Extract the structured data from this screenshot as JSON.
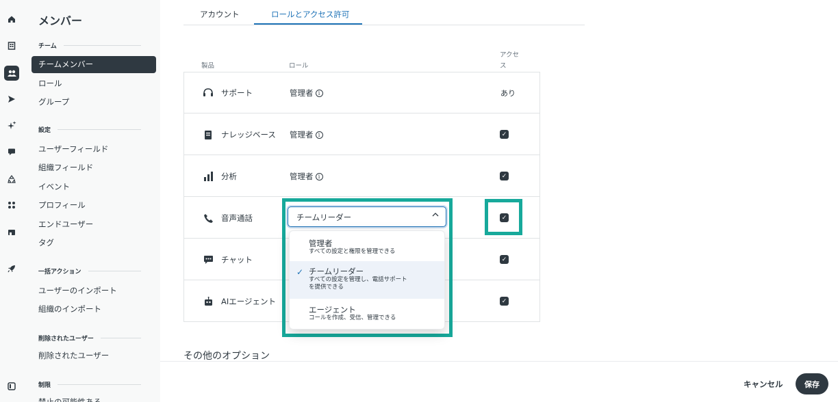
{
  "rail": {
    "icons": [
      "home-icon",
      "building-icon",
      "users-icon",
      "send-icon",
      "sparkles-icon",
      "chat-icon",
      "recycle-icon",
      "apps-icon",
      "store-icon",
      "rocket-icon",
      "panel-toggle-icon"
    ]
  },
  "nav": {
    "title": "メンバー",
    "sections": {
      "team": "チーム",
      "settings": "設定",
      "bulk": "一括アクション",
      "deleted": "削除されたユーザー",
      "limits": "制限"
    },
    "items": {
      "team_members": "チームメンバー",
      "roles": "ロール",
      "groups": "グループ",
      "user_fields": "ユーザーフィールド",
      "org_fields": "組織フィールド",
      "events": "イベント",
      "profiles": "プロフィール",
      "end_users": "エンドユーザー",
      "tags": "タグ",
      "user_import": "ユーザーのインポート",
      "org_import": "組織のインポート",
      "deleted_users": "削除されたユーザー",
      "partial_cut": "禁止の可能性ある"
    }
  },
  "tabs": {
    "account": "アカウント",
    "roles_access": "ロールとアクセス許可"
  },
  "table": {
    "headers": {
      "product": "製品",
      "role": "ロール",
      "access_line1": "アクセ",
      "access_line2": "ス"
    },
    "rows": [
      {
        "icon": "headset-icon",
        "product": "サポート",
        "role": "管理者",
        "access": "あり"
      },
      {
        "icon": "book-icon",
        "product": "ナレッジベース",
        "role": "管理者",
        "access": "checked"
      },
      {
        "icon": "bar-chart-icon",
        "product": "分析",
        "role": "管理者",
        "access": "checked"
      },
      {
        "icon": "phone-icon",
        "product": "音声通話",
        "role": "チームリーダー",
        "access": "checked"
      },
      {
        "icon": "message-icon",
        "product": "チャット",
        "role": "",
        "access": "checked"
      },
      {
        "icon": "robot-icon",
        "product": "AIエージェント",
        "role": "",
        "access": "checked"
      }
    ]
  },
  "select": {
    "value": "チームリーダー",
    "options": [
      {
        "label": "管理者",
        "desc": "すべての設定と権限を管理できる",
        "selected": false
      },
      {
        "label": "チームリーダー",
        "desc_line1": "すべての設定を管理し、電話サポート",
        "desc_line2": "を提供できる",
        "selected": true
      },
      {
        "label": "エージェント",
        "desc": "コールを作成、受信、管理できる",
        "selected": false
      }
    ]
  },
  "other_options": "その他のオプション",
  "footer": {
    "cancel": "キャンセル",
    "save": "保存"
  },
  "colors": {
    "accent": "#1f73b7",
    "highlight": "#17a99b",
    "dark": "#2f3941"
  }
}
